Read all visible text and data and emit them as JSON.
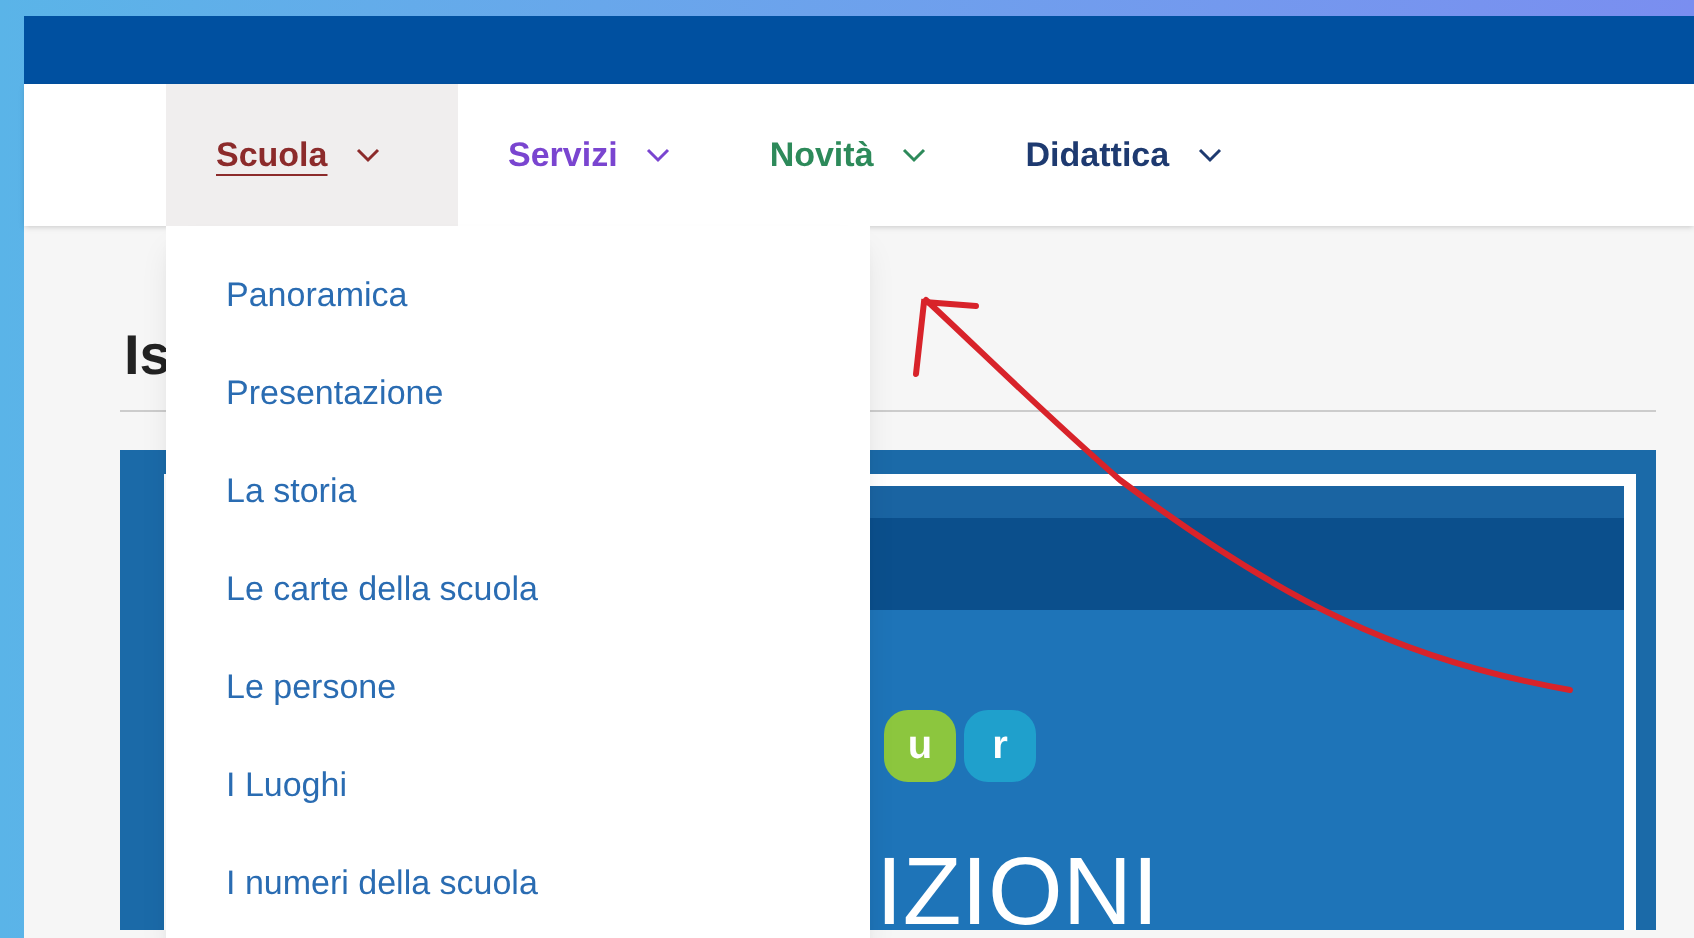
{
  "nav": {
    "items": [
      {
        "label": "Scuola",
        "selected": true,
        "color": "#8c2b2b"
      },
      {
        "label": "Servizi",
        "selected": false,
        "color": "#7a45d0"
      },
      {
        "label": "Novità",
        "selected": false,
        "color": "#2d8a5a"
      },
      {
        "label": "Didattica",
        "selected": false,
        "color": "#1e3a70"
      }
    ]
  },
  "dropdown": {
    "items": [
      "Panoramica",
      "Presentazione",
      "La storia",
      "Le carte della scuola",
      "Le persone",
      "I Luoghi",
      "I numeri della scuola"
    ]
  },
  "page_heading": "Is",
  "banner": {
    "logo_letters": [
      "u",
      "r"
    ],
    "headline": "IZIONI"
  }
}
